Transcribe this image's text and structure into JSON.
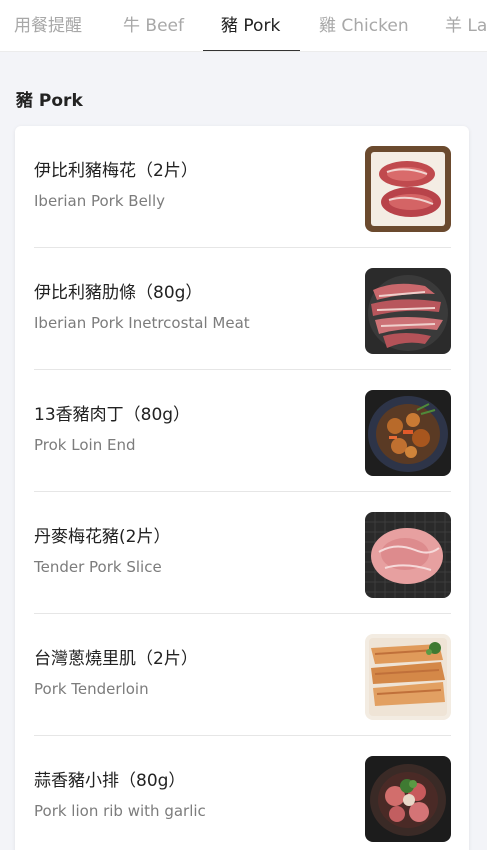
{
  "tabs": [
    {
      "label": "用餐提醒",
      "active": false
    },
    {
      "label": "牛 Beef",
      "active": false
    },
    {
      "label": "豬 Pork",
      "active": true
    },
    {
      "label": "雞 Chicken",
      "active": false
    },
    {
      "label": "羊 La",
      "active": false
    }
  ],
  "section": {
    "title": "豬 Pork"
  },
  "items": [
    {
      "zh": "伊比利豬梅花（2片）",
      "en": "Iberian Pork Belly",
      "image": "pork-belly-tray-photo"
    },
    {
      "zh": "伊比利豬肋條（80g）",
      "en": "Iberian Pork Inetrcostal Meat",
      "image": "intercostal-meat-plate-photo"
    },
    {
      "zh": "13香豬肉丁（80g）",
      "en": "Prok Loin End",
      "image": "diced-pork-bowl-photo"
    },
    {
      "zh": "丹麥梅花豬(2片）",
      "en": "Tender Pork Slice",
      "image": "pork-slice-grill-photo"
    },
    {
      "zh": "台灣蔥燒里肌（2片）",
      "en": "Pork Tenderloin",
      "image": "tenderloin-tray-photo"
    },
    {
      "zh": "蒜香豬小排（80g）",
      "en": "Pork lion rib with garlic",
      "image": "garlic-rib-bowl-photo"
    }
  ]
}
